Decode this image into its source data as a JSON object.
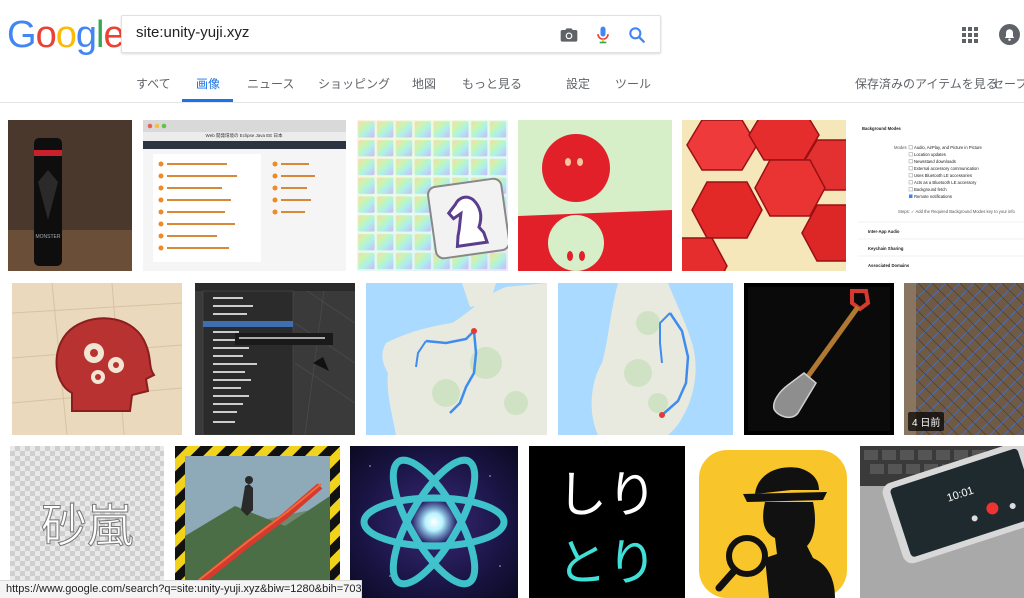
{
  "logo": {
    "letters": [
      "G",
      "o",
      "o",
      "g",
      "l",
      "e"
    ]
  },
  "search": {
    "query": "site:unity-yuji.xyz"
  },
  "tabs": {
    "all": "すべて",
    "images": "画像",
    "news": "ニュース",
    "shopping": "ショッピング",
    "maps": "地図",
    "more": "もっと見る",
    "settings": "設定",
    "tools": "ツール",
    "saved": "保存済みのアイテムを見る",
    "safe": "セーフ"
  },
  "results": {
    "badge_recent": "4 日前"
  },
  "thumb_text": {
    "monster": "MONSTER",
    "browser_title": "Web 開発環境の Eclipse Java EE 日本",
    "bg_modes_title": "Background Modes",
    "bg_modes_label": "Modes",
    "bg_modes_items": [
      "Audio, AirPlay, and Picture in Picture",
      "Location updates",
      "Newsstand downloads",
      "External accessory communication",
      "Uses Bluetooth LE accessories",
      "Acts as a Bluetooth LE accessory",
      "Background fetch",
      "Remote notifications"
    ],
    "bg_steps": "Steps: ✓ Add the Required Background Modes key to your info",
    "bg_extra": [
      "Inter-App Audio",
      "Keychain Sharing",
      "Associated Domains"
    ],
    "kanji_sand": "砂嵐",
    "shiritori_1": "しり",
    "shiritori_2": "とり",
    "phone_time": "10:01"
  },
  "status": {
    "url": "https://www.google.com/search?q=site:unity-yuji.xyz&biw=1280&bih=703&tbm="
  },
  "colors": {
    "blue": "#4285F4",
    "red": "#EA4335",
    "yellow": "#FBBC05",
    "green": "#34A853",
    "active_tab": "#1a73e8"
  }
}
